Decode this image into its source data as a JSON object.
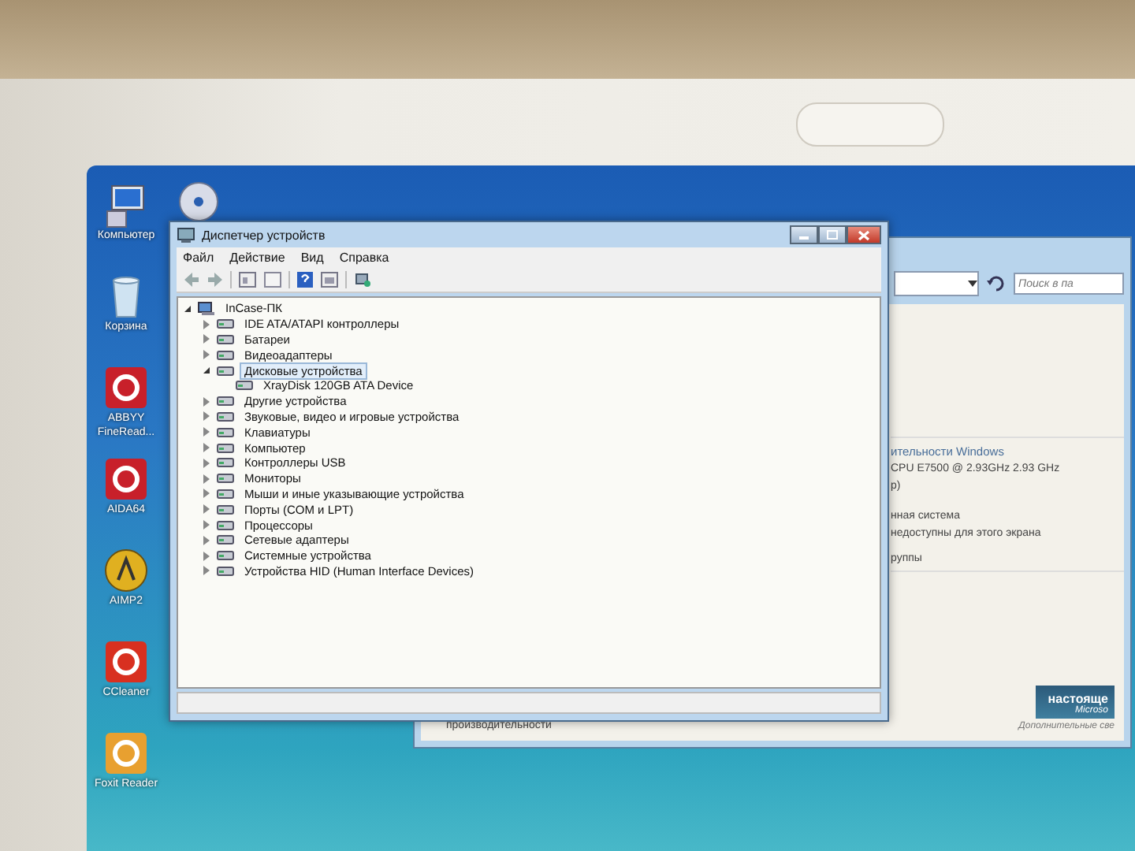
{
  "desktop_icons": [
    {
      "label": "Компьютер",
      "kind": "computer"
    },
    {
      "label": "Корзина",
      "kind": "bin"
    },
    {
      "label": "ABBYY FineRead...",
      "kind": "abbyy"
    },
    {
      "label": "AIDA64",
      "kind": "aida"
    },
    {
      "label": "AIMP2",
      "kind": "aimp"
    },
    {
      "label": "CCleaner",
      "kind": "ccleaner"
    },
    {
      "label": "Foxit Reader",
      "kind": "foxit"
    }
  ],
  "device_manager": {
    "title": "Диспетчер устройств",
    "menu": [
      "Файл",
      "Действие",
      "Вид",
      "Справка"
    ],
    "tree": {
      "label": "InCase-ПК",
      "expanded": true,
      "selected": false,
      "children": [
        {
          "label": "IDE ATA/ATAPI контроллеры",
          "expanded": false,
          "selected": false
        },
        {
          "label": "Батареи",
          "expanded": false,
          "selected": false
        },
        {
          "label": "Видеоадаптеры",
          "expanded": false,
          "selected": false
        },
        {
          "label": "Дисковые устройства",
          "expanded": true,
          "selected": true,
          "children": [
            {
              "label": "XrayDisk 120GB ATA Device",
              "selected": false
            }
          ]
        },
        {
          "label": "Другие устройства",
          "expanded": false,
          "selected": false
        },
        {
          "label": "Звуковые, видео и игровые устройства",
          "expanded": false,
          "selected": false
        },
        {
          "label": "Клавиатуры",
          "expanded": false,
          "selected": false
        },
        {
          "label": "Компьютер",
          "expanded": false,
          "selected": false
        },
        {
          "label": "Контроллеры USB",
          "expanded": false,
          "selected": false
        },
        {
          "label": "Мониторы",
          "expanded": false,
          "selected": false
        },
        {
          "label": "Мыши и иные указывающие устройства",
          "expanded": false,
          "selected": false
        },
        {
          "label": "Порты (COM и LPT)",
          "expanded": false,
          "selected": false
        },
        {
          "label": "Процессоры",
          "expanded": false,
          "selected": false
        },
        {
          "label": "Сетевые адаптеры",
          "expanded": false,
          "selected": false
        },
        {
          "label": "Системные устройства",
          "expanded": false,
          "selected": false
        },
        {
          "label": "Устройства HID (Human Interface Devices)",
          "expanded": false,
          "selected": false
        }
      ]
    }
  },
  "system_window": {
    "search": {
      "placeholder": "Поиск в па"
    },
    "lines": [
      "ительности Windows",
      "CPU    E7500  @ 2.93GHz   2.93 GHz",
      "р)",
      "нная система",
      "недоступны для этого экрана",
      "руппы"
    ],
    "footer_text": "производительности",
    "badge": [
      "настояще",
      "Microso"
    ],
    "link": "Дополнительные све"
  }
}
